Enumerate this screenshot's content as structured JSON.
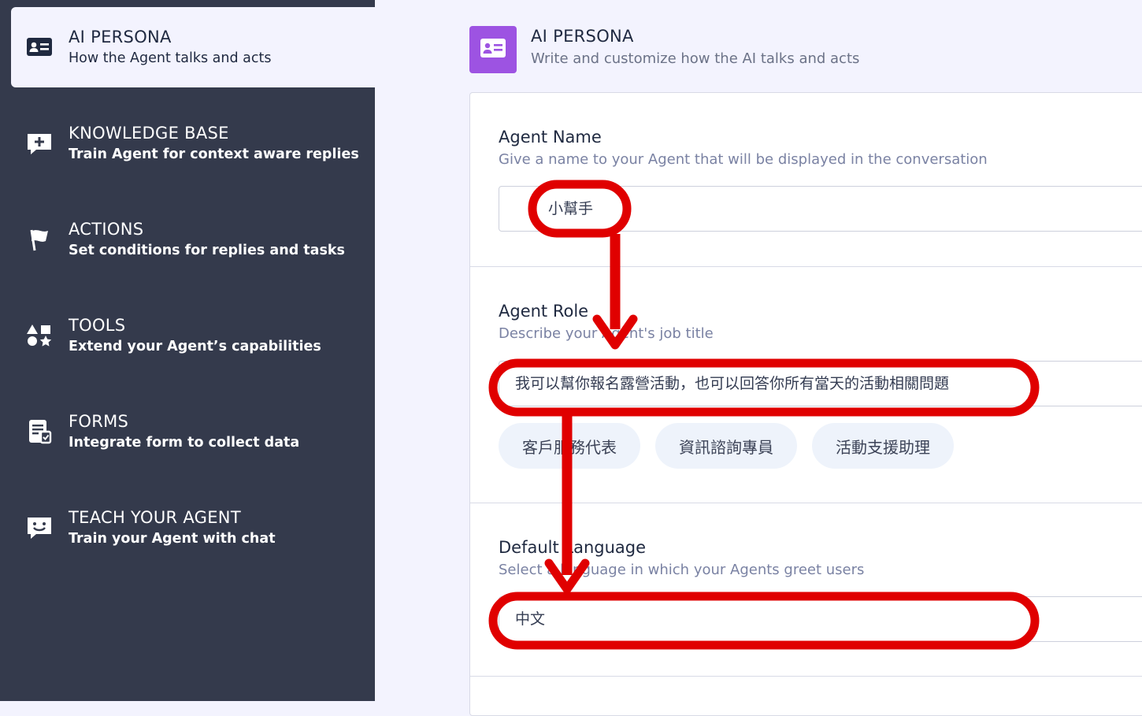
{
  "sidebar": {
    "items": [
      {
        "title": "AI PERSONA",
        "subtitle": "How the Agent talks and acts",
        "icon": "id-card-icon",
        "active": true
      },
      {
        "title": "KNOWLEDGE BASE",
        "subtitle": "Train Agent for context aware replies",
        "icon": "chat-plus-icon"
      },
      {
        "title": "ACTIONS",
        "subtitle": "Set conditions for replies and tasks",
        "icon": "flag-icon"
      },
      {
        "title": "TOOLS",
        "subtitle": "Extend your Agent’s capabilities",
        "icon": "shapes-icon"
      },
      {
        "title": "FORMS",
        "subtitle": "Integrate form to collect data",
        "icon": "form-icon"
      },
      {
        "title": "TEACH YOUR AGENT",
        "subtitle": "Train your Agent with chat",
        "icon": "smile-chat-icon"
      }
    ]
  },
  "header": {
    "title": "AI PERSONA",
    "subtitle": "Write and customize how the AI talks and acts",
    "icon": "id-card-icon"
  },
  "agent_name": {
    "label": "Agent Name",
    "description": "Give a name to your Agent that will be displayed in the conversation",
    "value": "小幫手"
  },
  "agent_role": {
    "label": "Agent Role",
    "description": "Describe your Agent's job title",
    "value": "我可以幫你報名露營活動，也可以回答你所有當天的活動相關問題",
    "suggestions": [
      "客戶服務代表",
      "資訊諮詢專員",
      "活動支援助理"
    ]
  },
  "default_language": {
    "label": "Default Language",
    "description": "Select a language in which your Agents greet users",
    "value": "中文"
  },
  "colors": {
    "sidebar_bg": "#343a4c",
    "accent_purple": "#9d53e2",
    "annotation_red": "#e00000"
  }
}
